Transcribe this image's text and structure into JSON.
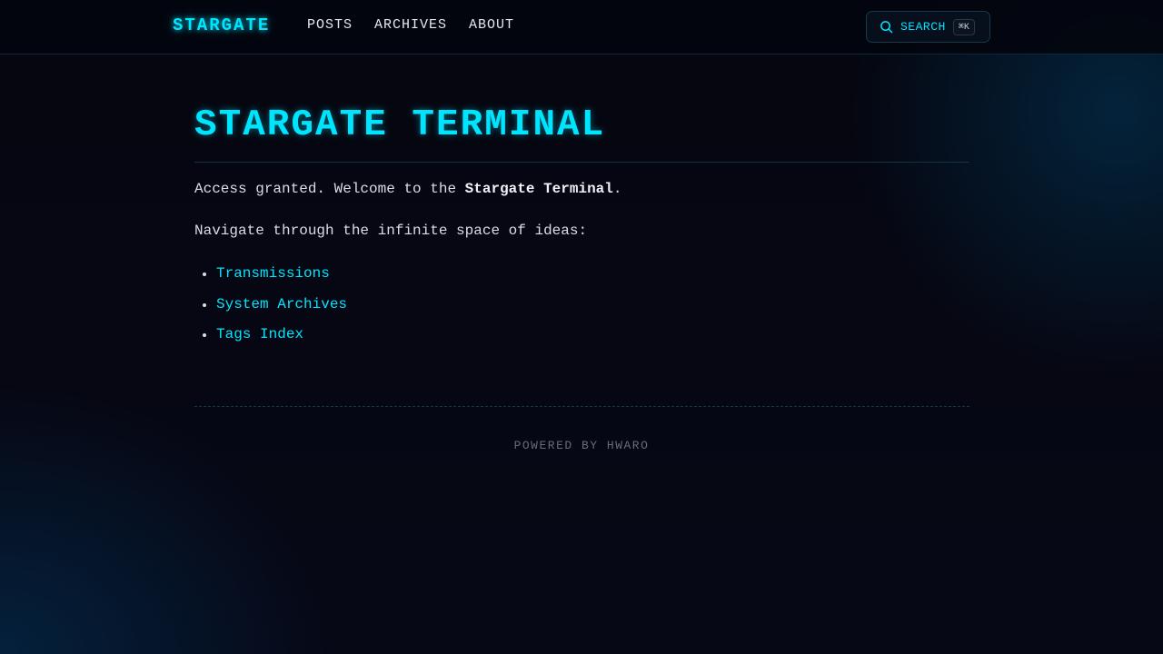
{
  "header": {
    "logo": "STARGATE",
    "nav": [
      "POSTS",
      "ARCHIVES",
      "ABOUT"
    ],
    "search": {
      "label": "SEARCH",
      "shortcut": "⌘K"
    }
  },
  "main": {
    "title": "STARGATE TERMINAL",
    "intro_prefix": "Access granted. Welcome to the ",
    "intro_bold": "Stargate Terminal",
    "intro_suffix": ".",
    "subtitle": "Navigate through the infinite space of ideas:",
    "links": [
      "Transmissions",
      "System Archives",
      "Tags Index"
    ]
  },
  "footer": {
    "text": "POWERED BY HWARO"
  },
  "colors": {
    "accent": "#00e5ff",
    "background": "#05060f"
  }
}
